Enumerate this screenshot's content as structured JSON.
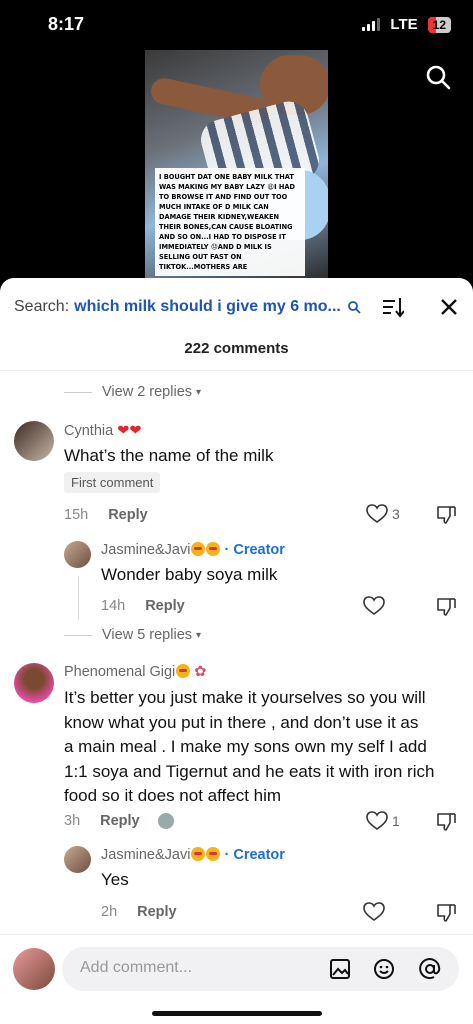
{
  "status": {
    "time": "8:17",
    "network": "LTE",
    "battery": "12"
  },
  "video": {
    "overlay_text": "I BOUGHT DAT ONE BABY MILK THAT WAS MAKING MY BABY LAZY 😩I HAD TO BROWSE IT AND FIND OUT TOO MUCH INTAKE OF D MILK CAN DAMAGE THEIR KIDNEY,WEAKEN THEIR BONES,CAN CAUSE BLOATING AND SO ON...I HAD TO DISPOSE IT IMMEDIATELY 😞AND D MILK IS SELLING OUT FAST ON TIKTOK...MOTHERS ARE"
  },
  "sheet": {
    "search_label": "Search:",
    "search_query": "which milk should i give my 6 mo...",
    "comments_count": "222 comments"
  },
  "comments": [
    {
      "view_replies": "View 2 replies"
    },
    {
      "username": "Cynthia",
      "text": "What’s the name of the milk",
      "badge": "First comment",
      "time": "15h",
      "reply_label": "Reply",
      "likes": "3",
      "reply": {
        "username": "Jasmine&Javi",
        "creator": "· Creator",
        "text": "Wonder baby soya milk",
        "time": "14h",
        "reply_label": "Reply"
      },
      "view_replies": "View 5 replies"
    },
    {
      "username": "Phenomenal Gigi",
      "text_lines": [
        "It’s better you just make it yourselves so you will",
        "know what you put in there , and don’t use it as",
        "a main meal . I make my sons own my self I add",
        "1:1 soya and Tigernut and he eats it with iron rich",
        "food so it does not affect him"
      ],
      "time": "3h",
      "reply_label": "Reply",
      "likes": "1",
      "reply": {
        "username": "Jasmine&Javi",
        "creator": "· Creator",
        "text": "Yes",
        "time": "2h",
        "reply_label": "Reply"
      }
    }
  ],
  "bottom": {
    "placeholder": "Add comment..."
  },
  "colors": {
    "accent": "#1e54b4",
    "creator": "#1e6fd0",
    "heart": "#e3262b"
  }
}
